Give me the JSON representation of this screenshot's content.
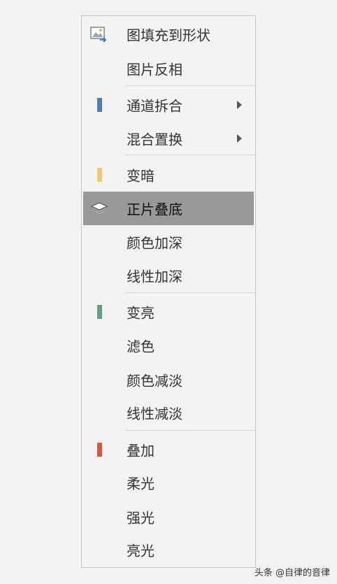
{
  "menu": {
    "items": [
      {
        "label": "图填充到形状",
        "icon": "picture-fill-icon"
      },
      {
        "label": "图片反相"
      },
      {
        "label": "通道拆合",
        "swatch": "#4a7fb5",
        "submenu": true
      },
      {
        "label": "混合置换",
        "submenu": true
      },
      {
        "label": "变暗",
        "swatch": "#f2c86a"
      },
      {
        "label": "正片叠底",
        "icon": "layers-icon",
        "highlighted": true
      },
      {
        "label": "颜色加深"
      },
      {
        "label": "线性加深"
      },
      {
        "label": "变亮",
        "swatch": "#5fa07f"
      },
      {
        "label": "滤色"
      },
      {
        "label": "颜色减淡"
      },
      {
        "label": "线性减淡"
      },
      {
        "label": "叠加",
        "swatch": "#d9573b"
      },
      {
        "label": "柔光"
      },
      {
        "label": "强光"
      },
      {
        "label": "亮光"
      }
    ]
  },
  "watermark": {
    "text": "头条 @自律的音律"
  }
}
